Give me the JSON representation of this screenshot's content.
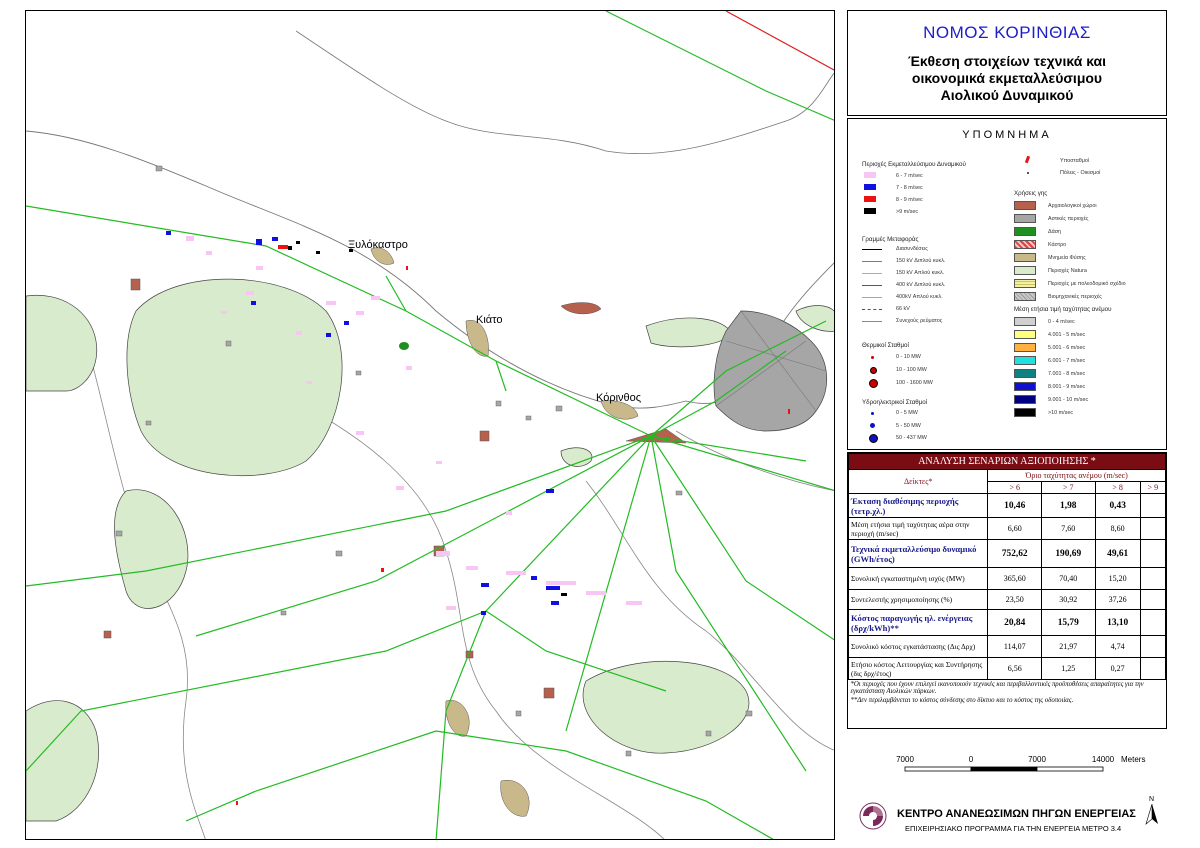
{
  "map": {
    "towns": [
      {
        "name": "Ξυλόκαστρο"
      },
      {
        "name": "Κιάτο"
      },
      {
        "name": "Κόρινθος"
      }
    ]
  },
  "title": {
    "prefecture": "ΝΟΜΟΣ ΚΟΡΙΝΘΙΑΣ",
    "line1": "Έκθεση στοιχείων τεχνικά και",
    "line2": "οικονομικά εκμεταλλεύσιμου",
    "line3": "Αιολικού Δυναμικού"
  },
  "legend": {
    "title": "ΥΠΟΜΝΗΜΑ",
    "potential_header": "Περιοχές Εκμεταλλεύσιμου Δυναμικού",
    "potential": [
      {
        "label": "6 - 7 m/sec",
        "color": "#f7c6f4"
      },
      {
        "label": "7 - 8 m/sec",
        "color": "#1010e0"
      },
      {
        "label": "8 - 9 m/sec",
        "color": "#ee1111"
      },
      {
        "label": ">9 m/sec",
        "color": "#000000"
      }
    ],
    "lines_header": "Γραμμές Μεταφοράς",
    "lines": [
      {
        "label": "Διασυνδέσεις",
        "color": "#000000"
      },
      {
        "label": "150 kV Διπλού κυκλ.",
        "color": "#22bb22"
      },
      {
        "label": "150 kV Απλού κυκλ.",
        "color": "#66dd66"
      },
      {
        "label": "400 kV Διπλού κυκλ.",
        "color": "#dd2222"
      },
      {
        "label": "400kV Απλού κυκλ.",
        "color": "#ee8888"
      },
      {
        "label": "66 kV",
        "color": "#555555"
      },
      {
        "label": "Συνεχούς ρεύματος",
        "color": "#888888"
      }
    ],
    "thermal_header": "Θερμικοί Σταθμοί",
    "thermal": [
      {
        "label": "0 - 10 MW"
      },
      {
        "label": "10 - 100 MW"
      },
      {
        "label": "100 - 1600 MW"
      }
    ],
    "hydro_header": "Υδροηλεκτρικοί Σταθμοί",
    "hydro": [
      {
        "label": "0 - 5 MW"
      },
      {
        "label": "5 - 50 MW"
      },
      {
        "label": "50 - 437 MW"
      }
    ],
    "substations": "Υποσταθμοί",
    "cities": "Πόλεις - Οικισμοί",
    "landuse_header": "Χρήσεις γης",
    "landuse": [
      {
        "label": "Αρχαιολογικοί χώροι",
        "color": "#b5614e"
      },
      {
        "label": "Αστικές περιοχές",
        "color": "#a6a6a6"
      },
      {
        "label": "Δάση",
        "color": "#1f8f1f"
      },
      {
        "label": "Κάστρο",
        "color": "#e9a6a6"
      },
      {
        "label": "Μνημεία Φύσης",
        "color": "#c9b98a"
      },
      {
        "label": "Περιοχές Natura",
        "color": "#d8ebcc"
      },
      {
        "label": "Περιοχές με πολεοδομικό σχέδιο",
        "color": "#f3f0a0"
      },
      {
        "label": "Βιομηχανικές περιοχές",
        "color": "#c8c8c8"
      }
    ],
    "wind_header": "Μέση ετήσια τιμή ταχύτητας ανέμου",
    "wind": [
      {
        "label": "0 - 4 m/sec",
        "color": "#d0d0d0"
      },
      {
        "label": "4.001 - 5 m/sec",
        "color": "#ffff80"
      },
      {
        "label": "5.001 - 6 m/sec",
        "color": "#ffb040"
      },
      {
        "label": "6.001 - 7 m/sec",
        "color": "#20e0e0"
      },
      {
        "label": "7.001 - 8 m/sec",
        "color": "#108080"
      },
      {
        "label": "8.001 - 9 m/sec",
        "color": "#1010d0"
      },
      {
        "label": "9.001 - 10 m/sec",
        "color": "#000080"
      },
      {
        "label": ">10 m/sec",
        "color": "#000000"
      }
    ]
  },
  "analysis": {
    "title": "ΑΝΑΛΥΣΗ ΣΕΝΑΡΙΩΝ ΑΞΙΟΠΟΙΗΣΗΣ *",
    "col_indicators": "Δείκτες*",
    "col_limit": "Όριο ταχύτητας ανέμου (m/sec)",
    "thresholds": [
      "> 6",
      "> 7",
      "> 8",
      "> 9"
    ],
    "rows": [
      {
        "label": "Έκταση διαθέσιμης περιοχής (τετρ.χλ.)",
        "values": [
          "10,46",
          "1,98",
          "0,43",
          ""
        ],
        "style": "bold"
      },
      {
        "label": "Μέση ετήσια τιμή ταχύτητας αέρα στην περιοχή (m/sec)",
        "values": [
          "6,60",
          "7,60",
          "8,60",
          ""
        ],
        "style": "normal"
      },
      {
        "label": "Τεχνικά εκμεταλλεύσιμο δυναμικό (GWh/έτος)",
        "values": [
          "752,62",
          "190,69",
          "49,61",
          ""
        ],
        "style": "bold"
      },
      {
        "label": "Συνολική εγκαταστημένη ισχύς (MW)",
        "values": [
          "365,60",
          "70,40",
          "15,20",
          ""
        ],
        "style": "normal"
      },
      {
        "label": "Συντελεστής χρησιμοποίησης (%)",
        "values": [
          "23,50",
          "30,92",
          "37,26",
          ""
        ],
        "style": "normal"
      },
      {
        "label": "Κόστος παραγωγής ηλ. ενέργειας (δρχ/kWh)**",
        "values": [
          "20,84",
          "15,79",
          "13,10",
          ""
        ],
        "style": "bold"
      },
      {
        "label": "Συνολικό κόστος εγκατάστασης (Δις Δρχ)",
        "values": [
          "114,07",
          "21,97",
          "4,74",
          ""
        ],
        "style": "normal"
      },
      {
        "label": "Ετήσιο κόστος Λειτουργίας και Συντήρησης (δις δρχ/έτος)",
        "values": [
          "6,56",
          "1,25",
          "0,27",
          ""
        ],
        "style": "normal"
      }
    ],
    "note1": "*Οι περιοχές που έχουν επιλεγεί ικανοποιούν τεχνικές και περιβαλλοντικές προϋποθέσεις απαραίτητες για την εγκατάσταση Αιολικών πάρκων.",
    "note2": "**Δεν περιλαμβάνεται το κόστος σύνδεσης στο δίκτυο και το κόστος της οδοποιίας."
  },
  "scale": {
    "labels": [
      "7000",
      "0",
      "7000",
      "14000"
    ],
    "unit": "Meters"
  },
  "footer": {
    "org": "ΚΕΝΤΡΟ ΑΝΑΝΕΩΣΙΜΩΝ ΠΗΓΩΝ ΕΝΕΡΓΕΙΑΣ",
    "program": "ΕΠΙΧΕΙΡΗΣΙΑΚΟ ΠΡΟΓΡΑΜΜΑ ΓΙΑ ΤΗΝ ΕΝΕΡΓΕΙΑ ΜΕΤΡΟ 3.4",
    "north": "N"
  }
}
